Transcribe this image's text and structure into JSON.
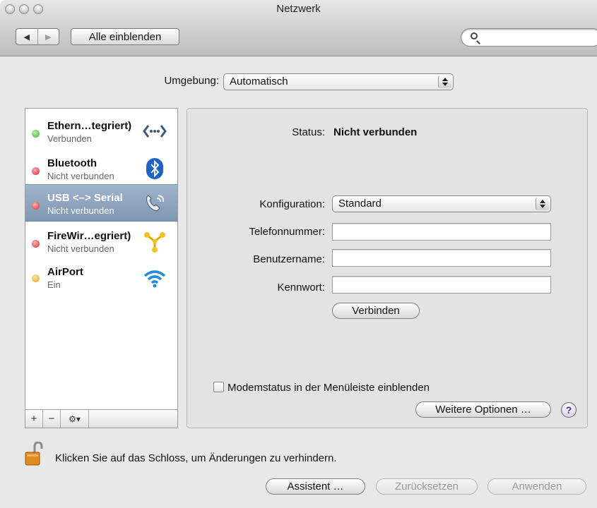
{
  "window": {
    "title": "Netzwerk"
  },
  "toolbar": {
    "back_glyph": "◀",
    "forward_glyph": "▶",
    "show_all_label": "Alle einblenden",
    "search_placeholder": "",
    "search_icon": "magnifier-icon"
  },
  "location": {
    "label": "Umgebung:",
    "value": "Automatisch"
  },
  "services": [
    {
      "name": "Ethern…tegriert)",
      "status": "Verbunden",
      "status_color": "#3fae2f",
      "icon": "ethernet-icon",
      "selected": false
    },
    {
      "name": "Bluetooth",
      "status": "Nicht verbunden",
      "status_color": "#d42a2a",
      "icon": "bluetooth-icon",
      "selected": false
    },
    {
      "name": "USB <–> Serial",
      "status": "Nicht verbunden",
      "status_color": "#d42a2a",
      "icon": "phone-icon",
      "selected": true
    },
    {
      "name": "FireWir…egriert)",
      "status": "Nicht verbunden",
      "status_color": "#d42a2a",
      "icon": "firewire-icon",
      "selected": false
    },
    {
      "name": "AirPort",
      "status": "Ein",
      "status_color": "#f0a21c",
      "icon": "wifi-icon",
      "selected": false
    }
  ],
  "sidebar_buttons": {
    "add": "+",
    "remove": "−",
    "action": "⚙▾"
  },
  "detail": {
    "status_label": "Status:",
    "status_value": "Nicht verbunden",
    "config_label": "Konfiguration:",
    "config_value": "Standard",
    "phone_label": "Telefonnummer:",
    "phone_value": "",
    "user_label": "Benutzername:",
    "user_value": "",
    "password_label": "Kennwort:",
    "password_value": "",
    "connect_button": "Verbinden",
    "modem_checkbox_label": "Modemstatus in der Menüleiste einblenden",
    "modem_checkbox_checked": false,
    "more_options_button": "Weitere Optionen …",
    "help_glyph": "?"
  },
  "footer": {
    "lock_text": "Klicken Sie auf das Schloss, um Änderungen zu verhindern.",
    "assistant_button": "Assistent …",
    "revert_button": "Zurücksetzen",
    "apply_button": "Anwenden"
  }
}
